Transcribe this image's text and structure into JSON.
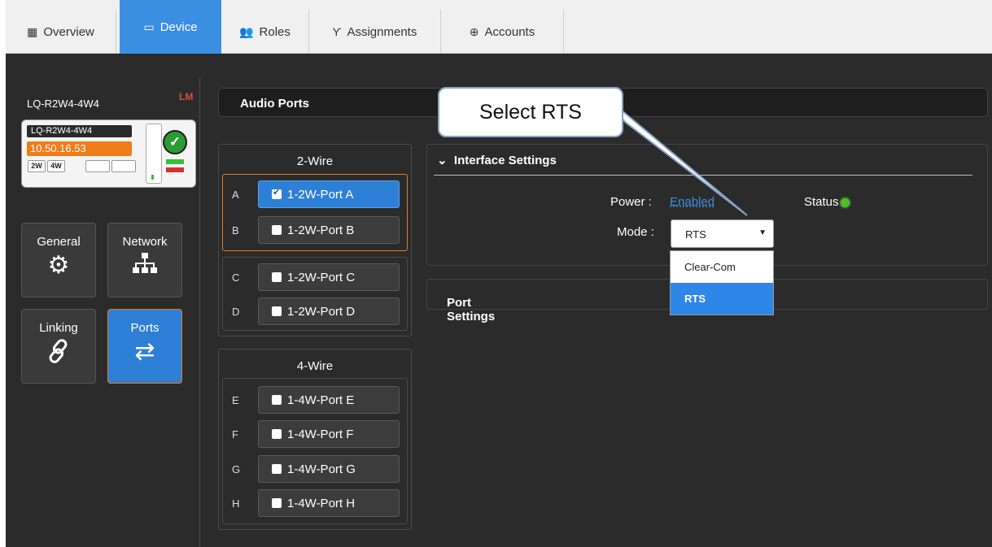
{
  "tabs": [
    {
      "label": "Overview",
      "icon": "grid-icon",
      "active": false
    },
    {
      "label": "Device",
      "icon": "device-icon",
      "active": true
    },
    {
      "label": "Roles",
      "icon": "people-icon",
      "active": false
    },
    {
      "label": "Assignments",
      "icon": "assignments-icon",
      "active": false
    },
    {
      "label": "Accounts",
      "icon": "accounts-icon",
      "active": false
    }
  ],
  "device": {
    "name": "LQ-R2W4-4W4",
    "badge": "LM",
    "card_name": "LQ-R2W4-4W4",
    "ip": "10.50.16.53",
    "chips": [
      "2W",
      "4W"
    ]
  },
  "nav": [
    {
      "label": "General",
      "icon": "gear-icon",
      "active": false
    },
    {
      "label": "Network",
      "icon": "network-icon",
      "active": false
    },
    {
      "label": "Linking",
      "icon": "link-icon",
      "active": false
    },
    {
      "label": "Ports",
      "icon": "swap-arrows-icon",
      "active": true
    }
  ],
  "audio_ports": {
    "title": "Audio Ports",
    "two_wire": {
      "title": "2-Wire",
      "ports": [
        {
          "letter": "A",
          "label": "1-2W-Port A",
          "checked": true
        },
        {
          "letter": "B",
          "label": "1-2W-Port B",
          "checked": false
        },
        {
          "letter": "C",
          "label": "1-2W-Port C",
          "checked": false
        },
        {
          "letter": "D",
          "label": "1-2W-Port D",
          "checked": false
        }
      ]
    },
    "four_wire": {
      "title": "4-Wire",
      "ports": [
        {
          "letter": "E",
          "label": "1-4W-Port E",
          "checked": false
        },
        {
          "letter": "F",
          "label": "1-4W-Port F",
          "checked": false
        },
        {
          "letter": "G",
          "label": "1-4W-Port G",
          "checked": false
        },
        {
          "letter": "H",
          "label": "1-4W-Port H",
          "checked": false
        }
      ]
    }
  },
  "interface_settings": {
    "title": "Interface Settings",
    "power_label": "Power :",
    "power_value": "Enabled",
    "status_label": "Status",
    "status_color": "#48c21c",
    "mode_label": "Mode :",
    "mode_value": "RTS",
    "mode_options": [
      "Clear-Com",
      "RTS"
    ],
    "highlighted_option": "RTS"
  },
  "port_settings": {
    "title": "Port Settings"
  },
  "callout": {
    "text": "Select RTS"
  },
  "colors": {
    "accent": "#3b8fe3",
    "ip_badge": "#ef7d1a",
    "selected_border": "#e27b2b"
  }
}
